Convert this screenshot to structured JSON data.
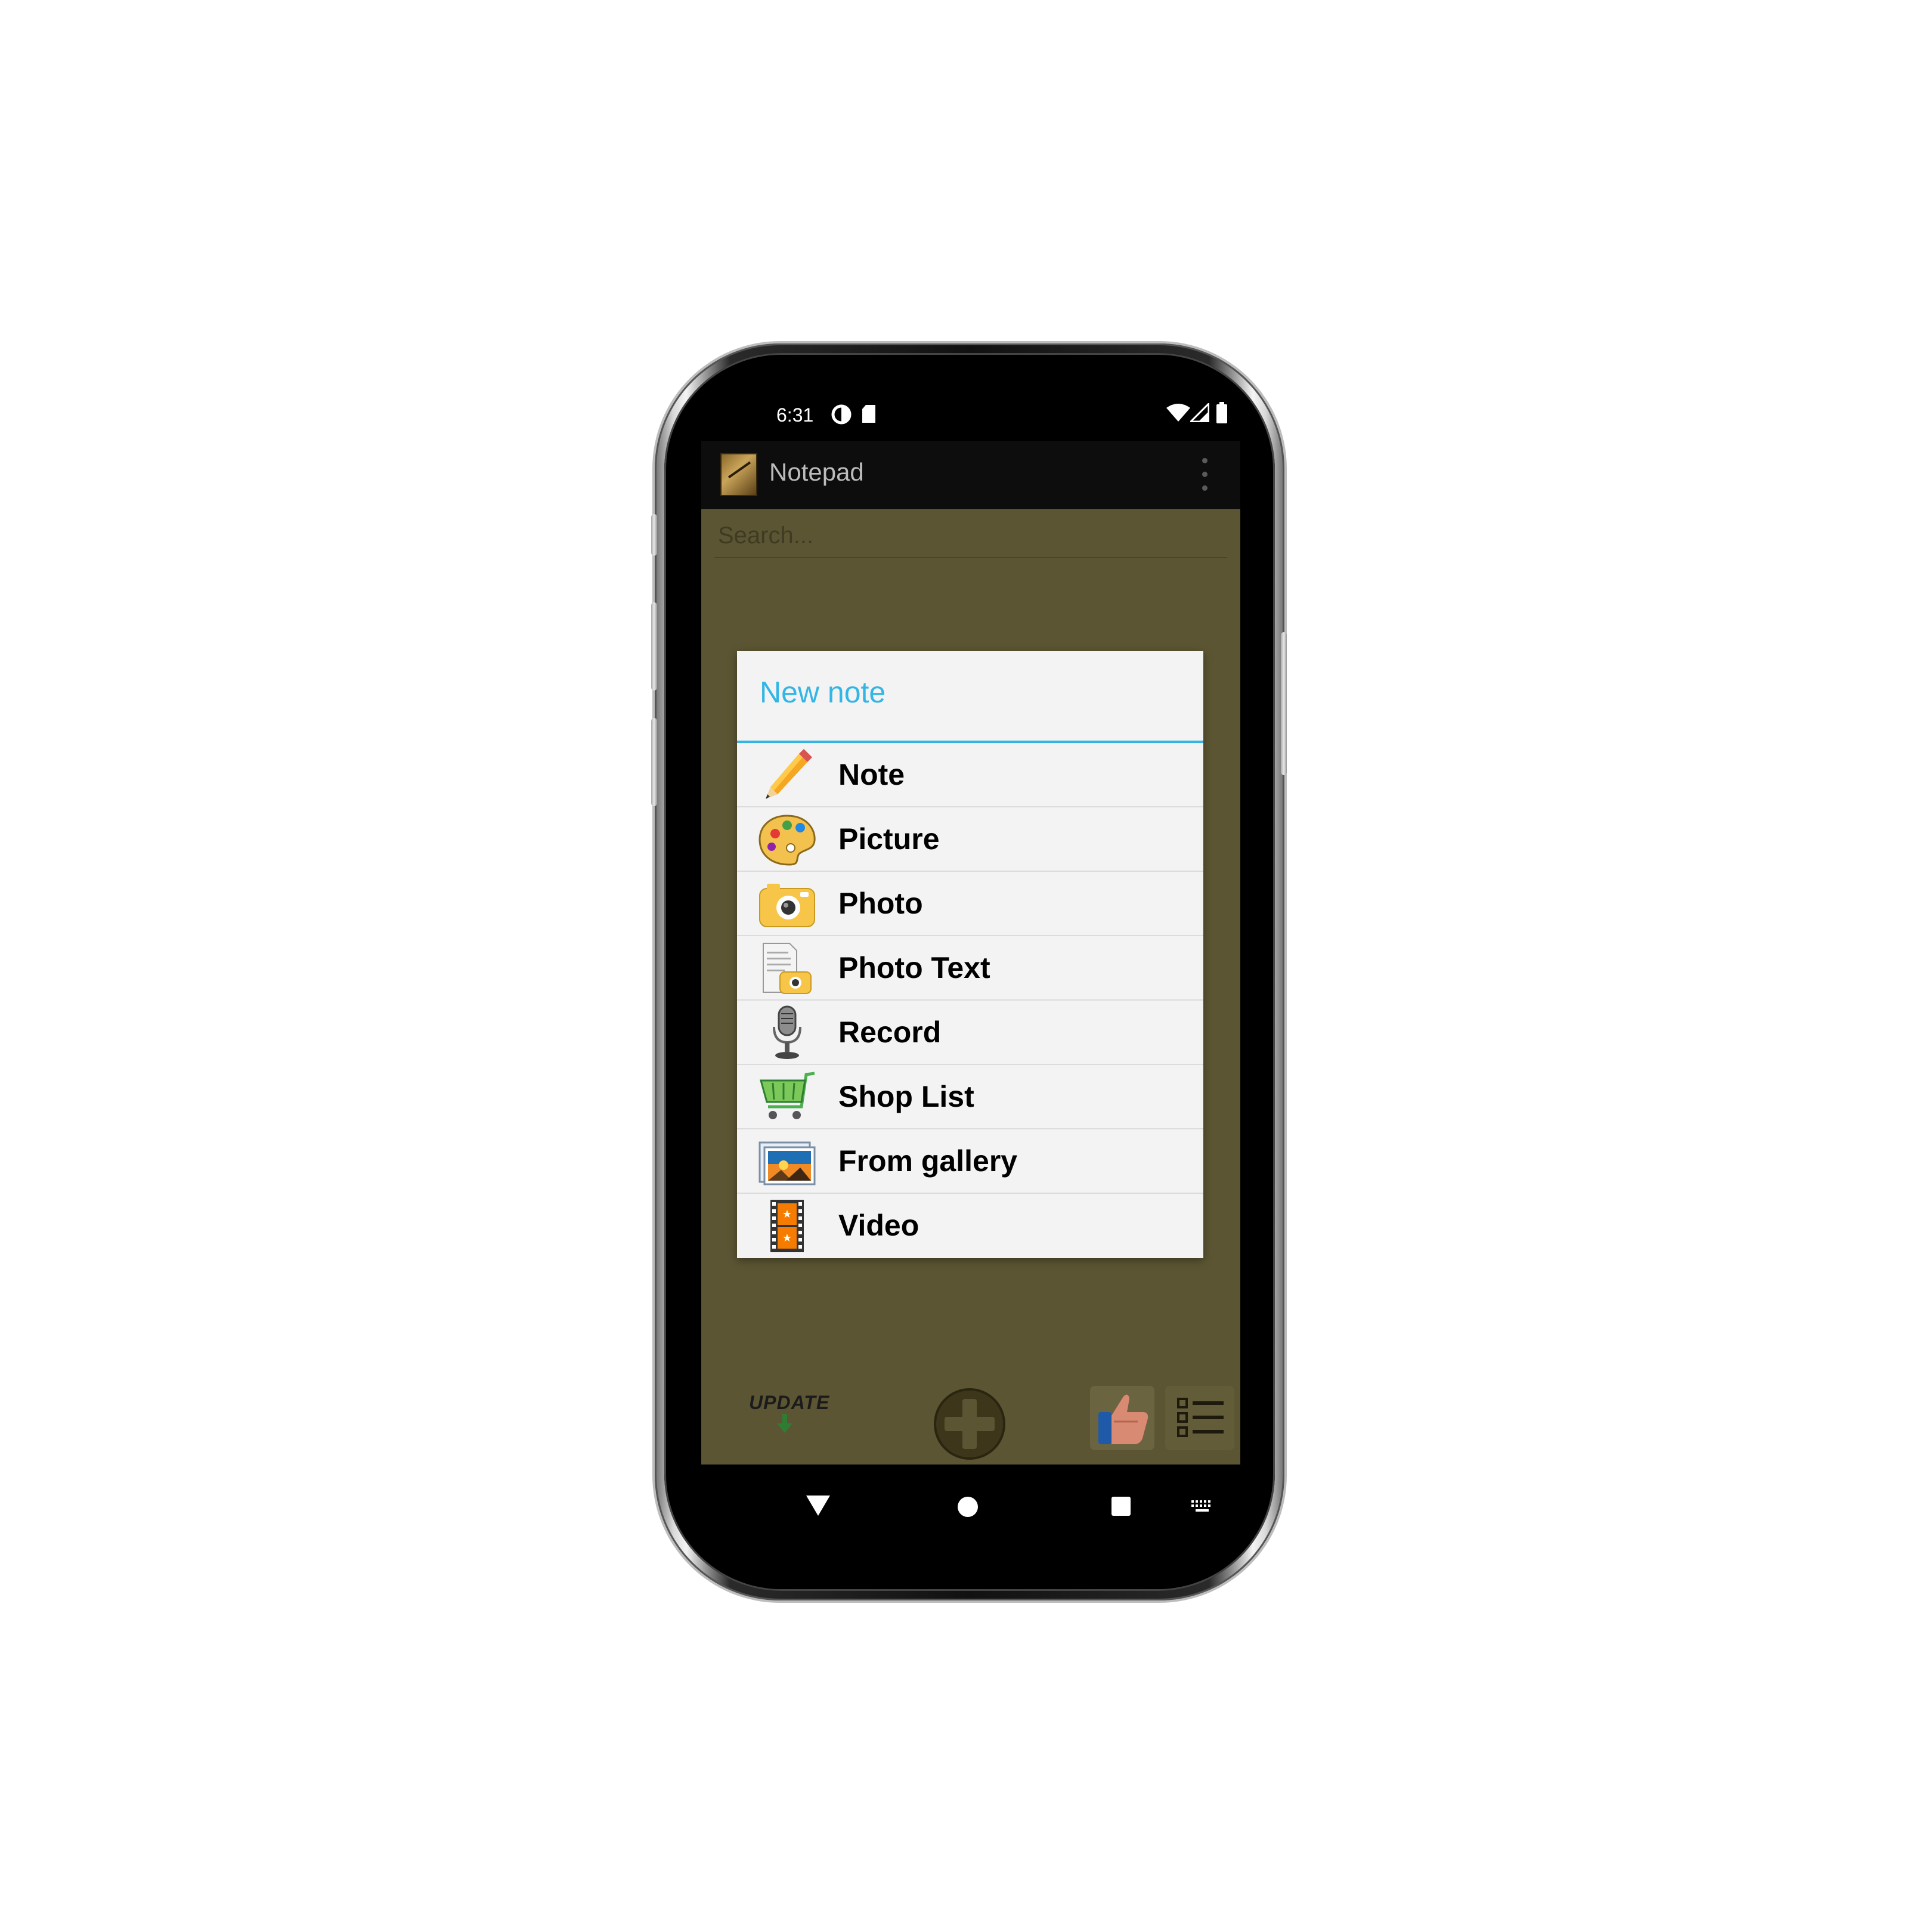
{
  "status_bar": {
    "time": "6:31",
    "left_icons": [
      "data-saver-icon",
      "sd-card-icon"
    ],
    "right_icons": [
      "wifi-icon",
      "signal-icon",
      "battery-icon"
    ]
  },
  "app_bar": {
    "title": "Notepad",
    "logo_icon": "notepad-logo-icon",
    "menu_icon": "overflow-menu-icon"
  },
  "search": {
    "placeholder": "Search..."
  },
  "dialog": {
    "title": "New note",
    "accent_color": "#33b5e5",
    "items": [
      {
        "label": "Note",
        "icon": "pencil-icon"
      },
      {
        "label": "Picture",
        "icon": "palette-icon"
      },
      {
        "label": "Photo",
        "icon": "camera-icon"
      },
      {
        "label": "Photo Text",
        "icon": "document-camera-icon"
      },
      {
        "label": "Record",
        "icon": "microphone-icon"
      },
      {
        "label": "Shop List",
        "icon": "shopping-cart-icon"
      },
      {
        "label": "From gallery",
        "icon": "gallery-icon"
      },
      {
        "label": "Video",
        "icon": "film-strip-icon"
      }
    ]
  },
  "bottom_bar": {
    "update_label": "UPDATE",
    "add_icon": "add-circle-icon",
    "like_icon": "thumbs-up-icon",
    "list_icon": "list-view-icon"
  },
  "nav_bar": {
    "icons": [
      "back-icon",
      "home-icon",
      "recents-icon",
      "keyboard-icon"
    ]
  },
  "colors": {
    "content_background": "#5b5533",
    "app_bar_background": "#0d0d0d",
    "dialog_background": "#f3f3f3"
  }
}
